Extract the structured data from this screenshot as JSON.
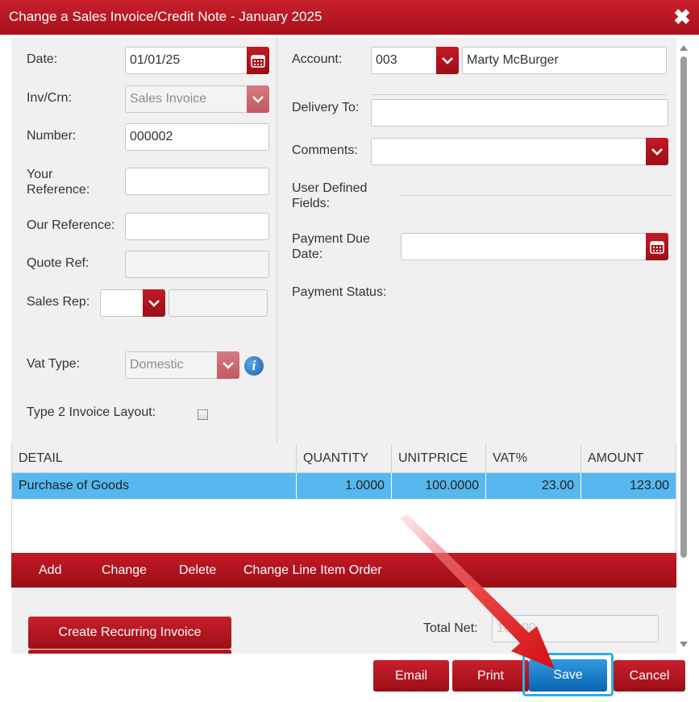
{
  "window": {
    "title": "Change a Sales Invoice/Credit Note - January 2025"
  },
  "left": {
    "date": {
      "label": "Date:",
      "value": "01/01/25"
    },
    "inv_crn": {
      "label": "Inv/Crn:",
      "value": "Sales Invoice"
    },
    "number": {
      "label": "Number:",
      "value": "000002"
    },
    "your_reference": {
      "label_line1": "Your",
      "label_line2": "Reference:",
      "value": ""
    },
    "our_reference": {
      "label": "Our Reference:",
      "value": ""
    },
    "quote_ref": {
      "label": "Quote Ref:",
      "value": ""
    },
    "sales_rep": {
      "label": "Sales Rep:",
      "code": "",
      "name": ""
    },
    "vat_type": {
      "label": "Vat Type:",
      "value": "Domestic"
    },
    "type2_layout": {
      "label": "Type 2 Invoice Layout:",
      "checked": false
    }
  },
  "right": {
    "account": {
      "label": "Account:",
      "code": "003",
      "name": "Marty McBurger"
    },
    "delivery_to": {
      "label": "Delivery To:",
      "value": ""
    },
    "comments": {
      "label": "Comments:",
      "value": ""
    },
    "user_defined": {
      "label_line1": "User Defined",
      "label_line2": "Fields:"
    },
    "payment_due": {
      "label_line1": "Payment Due",
      "label_line2": "Date:",
      "value": ""
    },
    "payment_status": {
      "label": "Payment Status:"
    }
  },
  "table": {
    "columns": [
      "DETAIL",
      "QUANTITY",
      "UNITPRICE",
      "VAT%",
      "AMOUNT"
    ],
    "rows": [
      {
        "detail": "Purchase of Goods",
        "quantity": "1.0000",
        "unitprice": "100.0000",
        "vat": "23.00",
        "amount": "123.00"
      }
    ]
  },
  "actions": {
    "add": "Add",
    "change": "Change",
    "delete": "Delete",
    "reorder": "Change Line Item Order"
  },
  "bottom": {
    "recurring": "Create Recurring Invoice",
    "total_net_label": "Total Net:",
    "total_net_value": "100.00"
  },
  "footer": {
    "email": "Email",
    "print": "Print",
    "save": "Save",
    "cancel": "Cancel"
  },
  "colors": {
    "brand_red": "#b5131e",
    "selected_row": "#56b8ee",
    "save_blue": "#1a7ac8",
    "highlight": "#2ab0e6"
  },
  "icons": [
    "close-icon",
    "calendar-icon",
    "chevron-down-icon",
    "info-icon",
    "arrow-pointer-icon"
  ]
}
